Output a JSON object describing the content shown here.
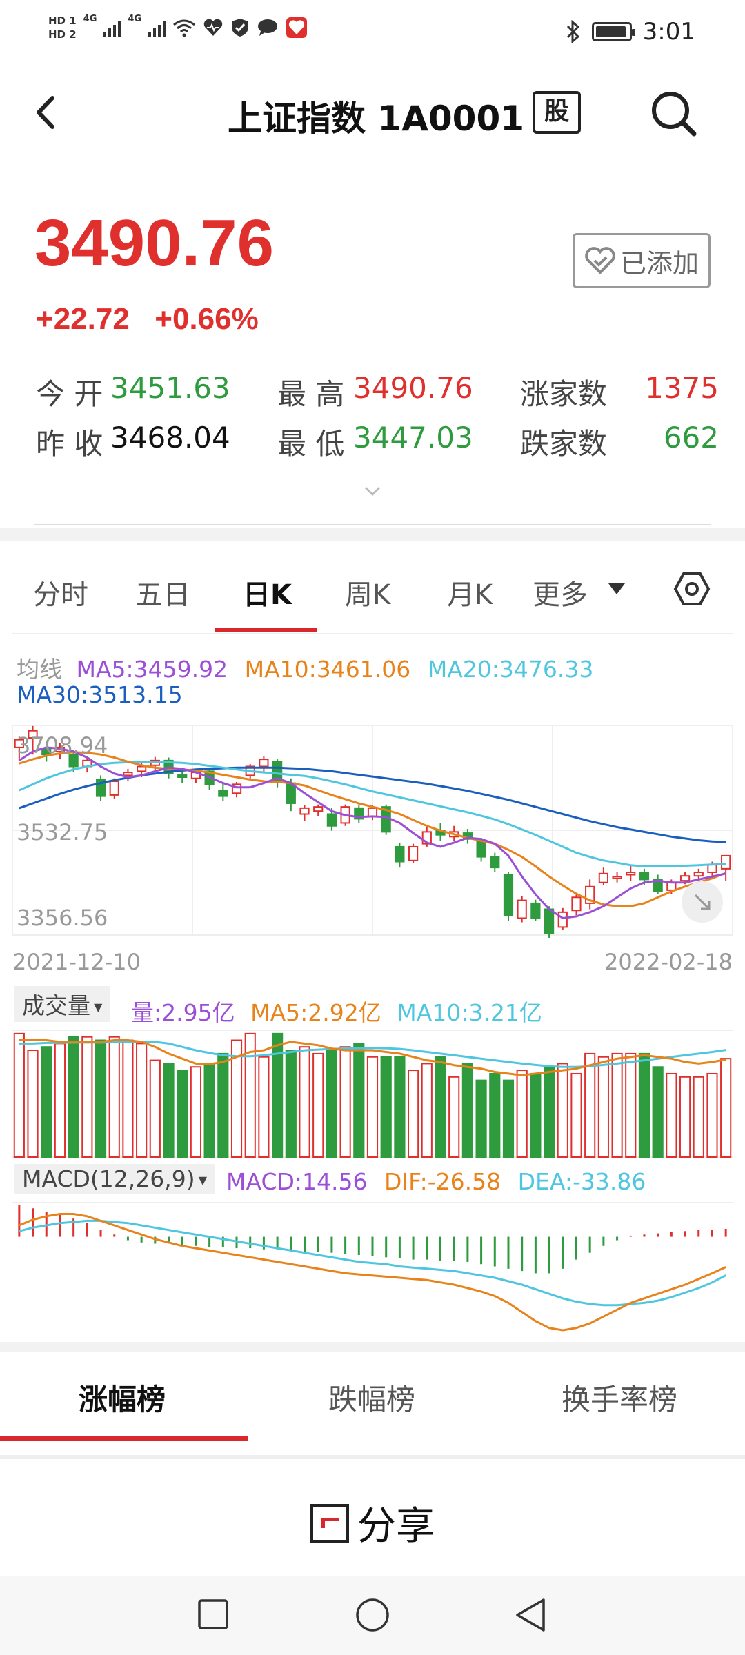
{
  "status_bar": {
    "time": "3:01",
    "left_text": [
      "HD 1",
      "HD 2",
      "4G",
      "4G"
    ]
  },
  "header": {
    "title": "上证指数 1A0001",
    "badge": "股"
  },
  "quote": {
    "price": "3490.76",
    "change": "+22.72",
    "change_pct": "+0.66%",
    "added_label": "已添加",
    "stats": [
      {
        "label": "今 开",
        "value": "3451.63"
      },
      {
        "label": "最 高",
        "value": "3490.76"
      },
      {
        "label": "涨家数",
        "value": "1375"
      },
      {
        "label": "昨 收",
        "value": "3468.04"
      },
      {
        "label": "最 低",
        "value": "3447.03"
      },
      {
        "label": "跌家数",
        "value": "662"
      }
    ]
  },
  "tabs": [
    "分时",
    "五日",
    "日K",
    "周K",
    "月K",
    "更多"
  ],
  "active_tab": "日K",
  "ma_legend": {
    "label": "均线",
    "ma5": "MA5:3459.92",
    "ma10": "MA10:3461.06",
    "ma20": "MA20:3476.33",
    "ma30": "MA30:3513.15"
  },
  "kline": {
    "y_labels": [
      "3708.94",
      "3532.75",
      "3356.56"
    ],
    "date_start": "2021-12-10",
    "date_end": "2022-02-18"
  },
  "volume": {
    "selector": "成交量",
    "value": "量:2.95亿",
    "ma5": "MA5:2.92亿",
    "ma10": "MA10:3.21亿"
  },
  "macd": {
    "selector": "MACD(12,26,9)",
    "macd": "MACD:14.56",
    "dif": "DIF:-26.58",
    "dea": "DEA:-33.86"
  },
  "colors": {
    "up": "#e0302d",
    "down": "#2e9b3e",
    "ma5": "#9b4fd6",
    "ma10": "#e8821a",
    "ma20": "#4fc6e0",
    "ma30": "#1a5fbf",
    "accent": "#d9282b"
  },
  "rank_tabs": [
    "涨幅榜",
    "跌幅榜",
    "换手率榜"
  ],
  "share_label": "分享",
  "chart_data": {
    "type": "candlestick",
    "ylim": [
      3356.56,
      3708.94
    ],
    "y_ticks": [
      3708.94,
      3532.75,
      3356.56
    ],
    "x_range": [
      "2021-12-10",
      "2022-02-18"
    ],
    "candles": [
      [
        3672,
        3685,
        3650,
        3690
      ],
      [
        3688,
        3700,
        3660,
        3708
      ],
      [
        3670,
        3660,
        3648,
        3682
      ],
      [
        3665,
        3672,
        3652,
        3680
      ],
      [
        3660,
        3640,
        3630,
        3668
      ],
      [
        3640,
        3650,
        3630,
        3656
      ],
      [
        3618,
        3590,
        3582,
        3625
      ],
      [
        3592,
        3615,
        3585,
        3620
      ],
      [
        3625,
        3630,
        3615,
        3636
      ],
      [
        3632,
        3640,
        3622,
        3648
      ],
      [
        3642,
        3650,
        3632,
        3656
      ],
      [
        3650,
        3628,
        3620,
        3655
      ],
      [
        3626,
        3622,
        3612,
        3632
      ],
      [
        3620,
        3630,
        3612,
        3636
      ],
      [
        3632,
        3610,
        3600,
        3638
      ],
      [
        3600,
        3590,
        3582,
        3612
      ],
      [
        3595,
        3610,
        3588,
        3614
      ],
      [
        3625,
        3640,
        3618,
        3644
      ],
      [
        3640,
        3652,
        3630,
        3658
      ],
      [
        3648,
        3615,
        3605,
        3652
      ],
      [
        3612,
        3578,
        3565,
        3620
      ],
      [
        3560,
        3570,
        3548,
        3575
      ],
      [
        3565,
        3572,
        3556,
        3576
      ],
      [
        3560,
        3540,
        3532,
        3570
      ],
      [
        3545,
        3572,
        3540,
        3576
      ],
      [
        3570,
        3552,
        3545,
        3576
      ],
      [
        3556,
        3570,
        3550,
        3575
      ],
      [
        3572,
        3530,
        3525,
        3576
      ],
      [
        3505,
        3480,
        3470,
        3512
      ],
      [
        3482,
        3505,
        3478,
        3510
      ],
      [
        3510,
        3530,
        3505,
        3540
      ],
      [
        3532,
        3525,
        3515,
        3545
      ],
      [
        3522,
        3530,
        3515,
        3540
      ],
      [
        3528,
        3518,
        3510,
        3535
      ],
      [
        3515,
        3488,
        3480,
        3520
      ],
      [
        3488,
        3470,
        3462,
        3495
      ],
      [
        3458,
        3390,
        3380,
        3462
      ],
      [
        3385,
        3415,
        3378,
        3422
      ],
      [
        3410,
        3385,
        3380,
        3416
      ],
      [
        3400,
        3360,
        3352,
        3405
      ],
      [
        3370,
        3395,
        3365,
        3402
      ],
      [
        3398,
        3420,
        3390,
        3428
      ],
      [
        3410,
        3438,
        3400,
        3450
      ],
      [
        3445,
        3460,
        3440,
        3470
      ],
      [
        3452,
        3455,
        3445,
        3462
      ],
      [
        3458,
        3462,
        3448,
        3475
      ],
      [
        3462,
        3450,
        3440,
        3468
      ],
      [
        3450,
        3430,
        3425,
        3458
      ],
      [
        3432,
        3445,
        3425,
        3450
      ],
      [
        3448,
        3456,
        3442,
        3462
      ],
      [
        3456,
        3462,
        3450,
        3468
      ],
      [
        3462,
        3475,
        3455,
        3480
      ],
      [
        3468,
        3490,
        3447,
        3491
      ]
    ],
    "ma5": [
      3650,
      3665,
      3672,
      3670,
      3665,
      3655,
      3640,
      3628,
      3622,
      3625,
      3632,
      3638,
      3636,
      3630,
      3622,
      3612,
      3605,
      3605,
      3612,
      3620,
      3612,
      3595,
      3580,
      3565,
      3558,
      3555,
      3556,
      3555,
      3545,
      3528,
      3512,
      3505,
      3512,
      3520,
      3518,
      3510,
      3490,
      3455,
      3425,
      3400,
      3385,
      3388,
      3395,
      3405,
      3420,
      3435,
      3445,
      3448,
      3445,
      3445,
      3450,
      3455,
      3460
    ],
    "ma10": [
      3645,
      3652,
      3658,
      3662,
      3664,
      3663,
      3660,
      3655,
      3648,
      3642,
      3638,
      3636,
      3635,
      3633,
      3630,
      3626,
      3622,
      3618,
      3615,
      3614,
      3612,
      3608,
      3600,
      3592,
      3585,
      3578,
      3572,
      3567,
      3560,
      3550,
      3540,
      3532,
      3526,
      3520,
      3515,
      3510,
      3500,
      3488,
      3472,
      3455,
      3440,
      3426,
      3415,
      3408,
      3405,
      3405,
      3410,
      3420,
      3430,
      3438,
      3445,
      3452,
      3461
    ],
    "ma20": [
      3600,
      3610,
      3620,
      3628,
      3635,
      3640,
      3644,
      3646,
      3647,
      3648,
      3648,
      3647,
      3646,
      3644,
      3641,
      3638,
      3635,
      3632,
      3630,
      3628,
      3626,
      3624,
      3620,
      3615,
      3610,
      3604,
      3598,
      3593,
      3588,
      3583,
      3578,
      3573,
      3568,
      3563,
      3557,
      3551,
      3543,
      3534,
      3525,
      3515,
      3505,
      3495,
      3488,
      3482,
      3478,
      3474,
      3472,
      3472,
      3472,
      3473,
      3474,
      3475,
      3476
    ],
    "ma30": [
      3570,
      3578,
      3586,
      3594,
      3601,
      3607,
      3612,
      3617,
      3621,
      3625,
      3628,
      3631,
      3633,
      3635,
      3636,
      3637,
      3638,
      3638,
      3638,
      3638,
      3637,
      3636,
      3634,
      3632,
      3629,
      3626,
      3623,
      3620,
      3617,
      3614,
      3611,
      3607,
      3603,
      3599,
      3594,
      3589,
      3584,
      3578,
      3572,
      3566,
      3560,
      3554,
      3548,
      3543,
      3538,
      3534,
      3530,
      3526,
      3522,
      3519,
      3516,
      3514,
      3513
    ],
    "volume_bars": [
      3.7,
      3.2,
      3.3,
      3.4,
      3.6,
      3.6,
      3.5,
      3.6,
      3.5,
      3.4,
      2.9,
      2.8,
      2.6,
      2.7,
      2.8,
      3.1,
      3.5,
      3.7,
      3.0,
      3.7,
      3.2,
      3.3,
      3.1,
      3.2,
      3.3,
      3.4,
      3.0,
      3.0,
      3.0,
      2.6,
      2.8,
      3.0,
      2.4,
      2.8,
      2.3,
      2.5,
      2.3,
      2.6,
      2.5,
      2.7,
      2.8,
      2.5,
      3.1,
      3.0,
      3.1,
      3.1,
      3.1,
      2.7,
      2.5,
      2.4,
      2.4,
      2.5,
      2.95
    ],
    "volume_ylim": [
      0,
      3.8
    ],
    "vol_ma5": [
      3.5,
      3.5,
      3.5,
      3.45,
      3.45,
      3.45,
      3.45,
      3.5,
      3.5,
      3.45,
      3.3,
      3.1,
      2.95,
      2.8,
      2.78,
      2.85,
      3.0,
      3.15,
      3.2,
      3.35,
      3.45,
      3.4,
      3.35,
      3.25,
      3.2,
      3.2,
      3.2,
      3.15,
      3.1,
      3.0,
      2.9,
      2.85,
      2.75,
      2.7,
      2.65,
      2.55,
      2.5,
      2.45,
      2.5,
      2.55,
      2.6,
      2.65,
      2.75,
      2.85,
      2.95,
      3.0,
      3.05,
      3.0,
      2.95,
      2.85,
      2.8,
      2.85,
      2.92
    ],
    "vol_ma10": [
      3.4,
      3.4,
      3.42,
      3.42,
      3.43,
      3.43,
      3.43,
      3.44,
      3.45,
      3.45,
      3.45,
      3.4,
      3.3,
      3.2,
      3.12,
      3.05,
      3.02,
      3.02,
      3.05,
      3.1,
      3.15,
      3.2,
      3.22,
      3.24,
      3.25,
      3.26,
      3.27,
      3.26,
      3.24,
      3.2,
      3.15,
      3.1,
      3.05,
      3.0,
      2.95,
      2.9,
      2.85,
      2.8,
      2.76,
      2.72,
      2.7,
      2.7,
      2.72,
      2.76,
      2.8,
      2.85,
      2.9,
      2.95,
      3.0,
      3.05,
      3.1,
      3.15,
      3.21
    ],
    "macd_hist": [
      28,
      25,
      22,
      20,
      16,
      12,
      6,
      2,
      -3,
      -5,
      -6,
      -6,
      -7,
      -8,
      -9,
      -9,
      -10,
      -10,
      -11,
      -11,
      -12,
      -13,
      -13,
      -14,
      -15,
      -16,
      -17,
      -18,
      -19,
      -20,
      -20,
      -21,
      -21,
      -22,
      -24,
      -26,
      -28,
      -30,
      -32,
      -32,
      -28,
      -20,
      -14,
      -8,
      -3,
      1,
      2,
      3,
      4,
      5,
      6,
      6,
      7
    ],
    "macd_dif": [
      10,
      15,
      18,
      20,
      20,
      18,
      14,
      10,
      6,
      2,
      -2,
      -5,
      -8,
      -10,
      -12,
      -14,
      -16,
      -18,
      -20,
      -22,
      -24,
      -26,
      -28,
      -30,
      -32,
      -33,
      -34,
      -35,
      -36,
      -37,
      -38,
      -40,
      -42,
      -45,
      -48,
      -52,
      -58,
      -66,
      -74,
      -80,
      -82,
      -80,
      -76,
      -70,
      -64,
      -58,
      -54,
      -50,
      -46,
      -42,
      -37,
      -32,
      -26.58
    ],
    "macd_dea": [
      5,
      8,
      10,
      12,
      13,
      14,
      14,
      13,
      12,
      10,
      8,
      6,
      4,
      2,
      0,
      -2,
      -4,
      -6,
      -8,
      -10,
      -12,
      -14,
      -16,
      -18,
      -20,
      -22,
      -23,
      -24,
      -26,
      -27,
      -28,
      -29,
      -30,
      -32,
      -34,
      -36,
      -39,
      -42,
      -46,
      -50,
      -54,
      -57,
      -59,
      -60,
      -60,
      -59,
      -58,
      -56,
      -53,
      -49,
      -45,
      -40,
      -33.86
    ],
    "macd_ylim": [
      -85,
      30
    ]
  }
}
